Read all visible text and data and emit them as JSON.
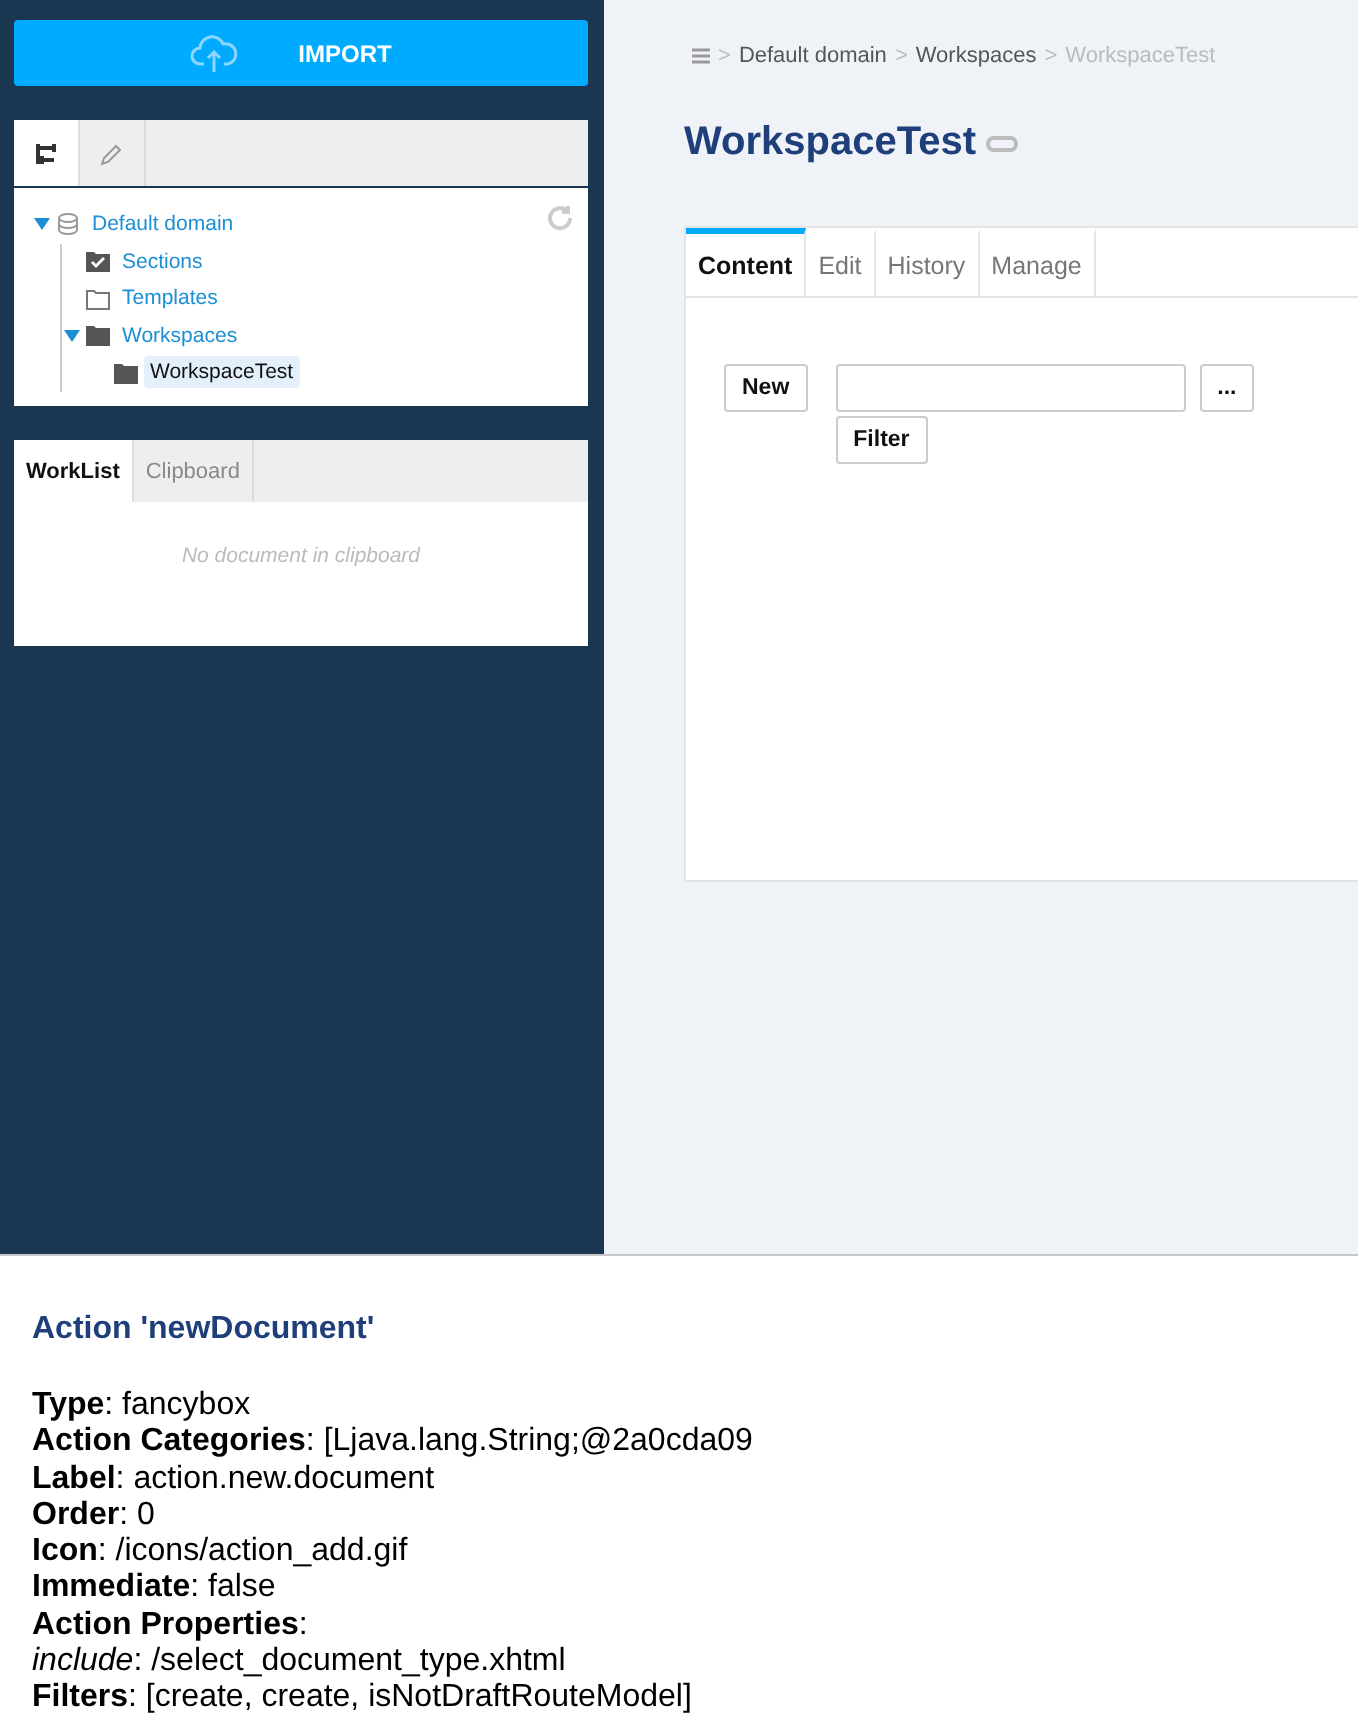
{
  "sidebar": {
    "import_button": "IMPORT",
    "panel_tabs": [
      {
        "kind": "tree",
        "selected": true
      },
      {
        "kind": "edit",
        "selected": false
      }
    ],
    "tree": [
      {
        "label": "Default domain",
        "kind": "domain",
        "expanded": true,
        "selected": false,
        "children": [
          {
            "label": "Sections",
            "kind": "section",
            "selected": false
          },
          {
            "label": "Templates",
            "kind": "templates",
            "selected": false
          },
          {
            "label": "Workspaces",
            "kind": "folder",
            "expanded": true,
            "selected": false,
            "children": [
              {
                "label": "WorkspaceTest",
                "kind": "folder",
                "selected": true
              }
            ]
          }
        ]
      }
    ],
    "lower_tabs": [
      {
        "label": "WorkList",
        "selected": true
      },
      {
        "label": "Clipboard",
        "selected": false
      }
    ],
    "empty_message": "No document in clipboard"
  },
  "breadcrumb": {
    "separator": ">",
    "items": [
      {
        "label": "Default domain",
        "current": false
      },
      {
        "label": "Workspaces",
        "current": false
      },
      {
        "label": "WorkspaceTest",
        "current": true
      }
    ]
  },
  "title": "WorkspaceTest",
  "tabs": [
    {
      "label": "Content",
      "selected": true
    },
    {
      "label": "Edit",
      "selected": false
    },
    {
      "label": "History",
      "selected": false
    },
    {
      "label": "Manage",
      "selected": false
    }
  ],
  "content": {
    "new_button": "New",
    "browse_button": "...",
    "filter_button": "Filter"
  },
  "details": {
    "title": "Action 'newDocument'",
    "lines": [
      "**Type**: fancybox",
      "**Action Categories**: [Ljava.lang.String;@2a0cda09",
      "**Label**: action.new.document",
      "**Order**: 0",
      "**Icon**: /icons/action_add.gif",
      "**Immediate**: false",
      "**Action Properties**:",
      "*include*: /select_document_type.xhtml",
      "**Filters**: [create, create, isNotDraftRouteModel]"
    ]
  }
}
